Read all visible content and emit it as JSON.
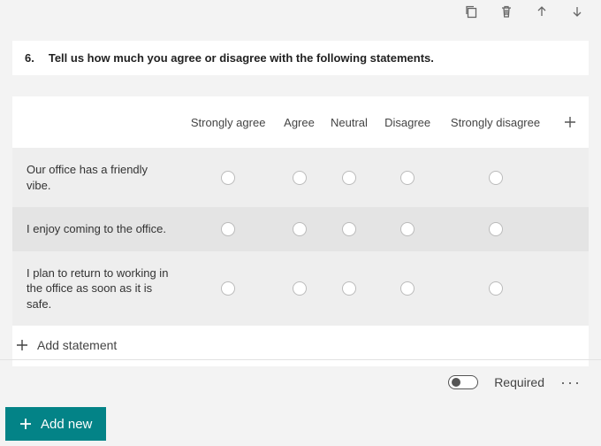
{
  "toolbar": {
    "copy": "copy",
    "delete": "delete",
    "up": "move-up",
    "down": "move-down"
  },
  "question": {
    "number": "6.",
    "text": "Tell us how much you agree or disagree with the following statements."
  },
  "likert": {
    "columns": [
      "Strongly agree",
      "Agree",
      "Neutral",
      "Disagree",
      "Strongly disagree"
    ],
    "statements": [
      "Our office has a friendly vibe.",
      "I enjoy coming to the office.",
      "I plan to return to working in the office as soon as it is safe."
    ],
    "add_statement_label": "Add statement"
  },
  "footer": {
    "required_label": "Required",
    "required_on": false
  },
  "add_new_label": "Add new"
}
